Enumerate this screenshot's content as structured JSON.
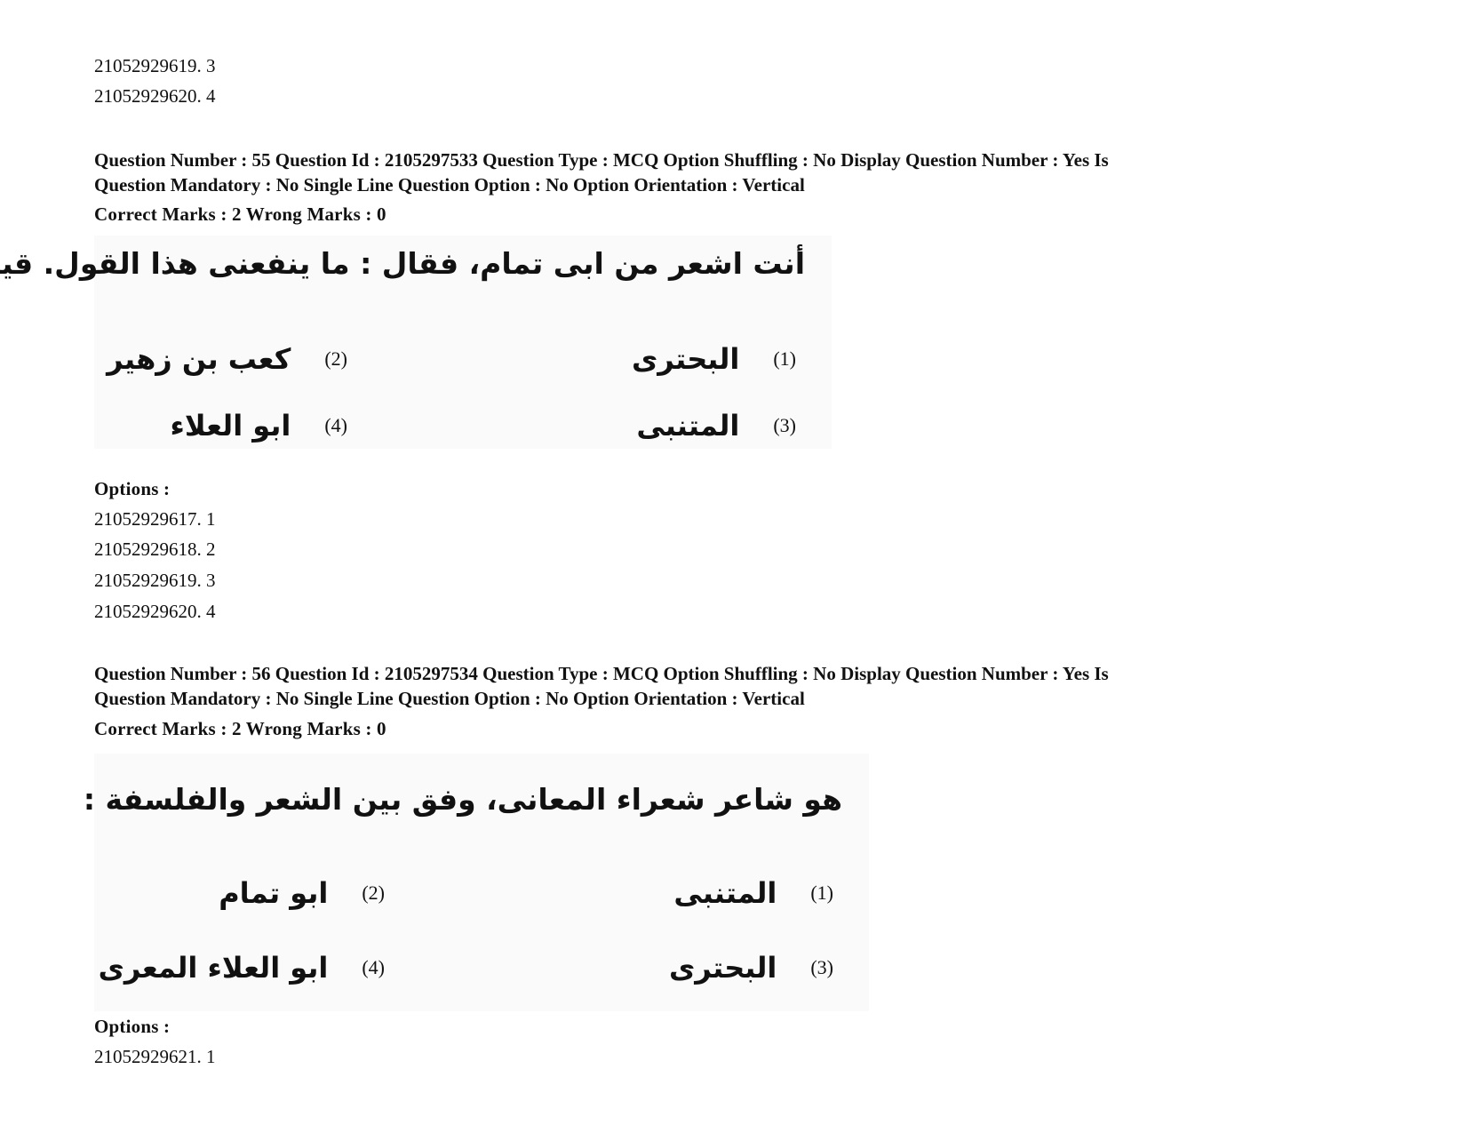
{
  "prev_options_tail": [
    {
      "id": "21052929619",
      "value": "3"
    },
    {
      "id": "21052929620",
      "value": "4"
    }
  ],
  "questions": [
    {
      "meta_line1": "Question Number : 55 Question Id : 2105297533 Question Type : MCQ Option Shuffling : No Display Question Number : Yes Is",
      "meta_line2": "Question Mandatory : No Single Line Question Option : No Option Orientation : Vertical",
      "marks": "Correct Marks : 2 Wrong Marks : 0",
      "stem": "أنت اشعر من ابى تمام، فقال : ما ينفعنى هذا القول. قيل فى :",
      "choices": [
        {
          "num": "(1)",
          "text": "البحترى"
        },
        {
          "num": "(2)",
          "text": "كعب بن زهير"
        },
        {
          "num": "(3)",
          "text": "المتنبى"
        },
        {
          "num": "(4)",
          "text": "ابو العلاء"
        }
      ],
      "options_label": "Options :",
      "options": [
        {
          "id": "21052929617",
          "value": "1"
        },
        {
          "id": "21052929618",
          "value": "2"
        },
        {
          "id": "21052929619",
          "value": "3"
        },
        {
          "id": "21052929620",
          "value": "4"
        }
      ]
    },
    {
      "meta_line1": "Question Number : 56 Question Id : 2105297534 Question Type : MCQ Option Shuffling : No Display Question Number : Yes Is",
      "meta_line2": "Question Mandatory : No Single Line Question Option : No Option Orientation : Vertical",
      "marks": "Correct Marks : 2 Wrong Marks : 0",
      "stem": "هو شاعر شعراء المعانى، وفق بين الشعر والفلسفة :",
      "choices": [
        {
          "num": "(1)",
          "text": "المتنبى"
        },
        {
          "num": "(2)",
          "text": "ابو تمام"
        },
        {
          "num": "(3)",
          "text": "البحترى"
        },
        {
          "num": "(4)",
          "text": "ابو العلاء المعرى"
        }
      ],
      "options_label": "Options :",
      "options": [
        {
          "id": "21052929621",
          "value": "1"
        }
      ]
    }
  ]
}
